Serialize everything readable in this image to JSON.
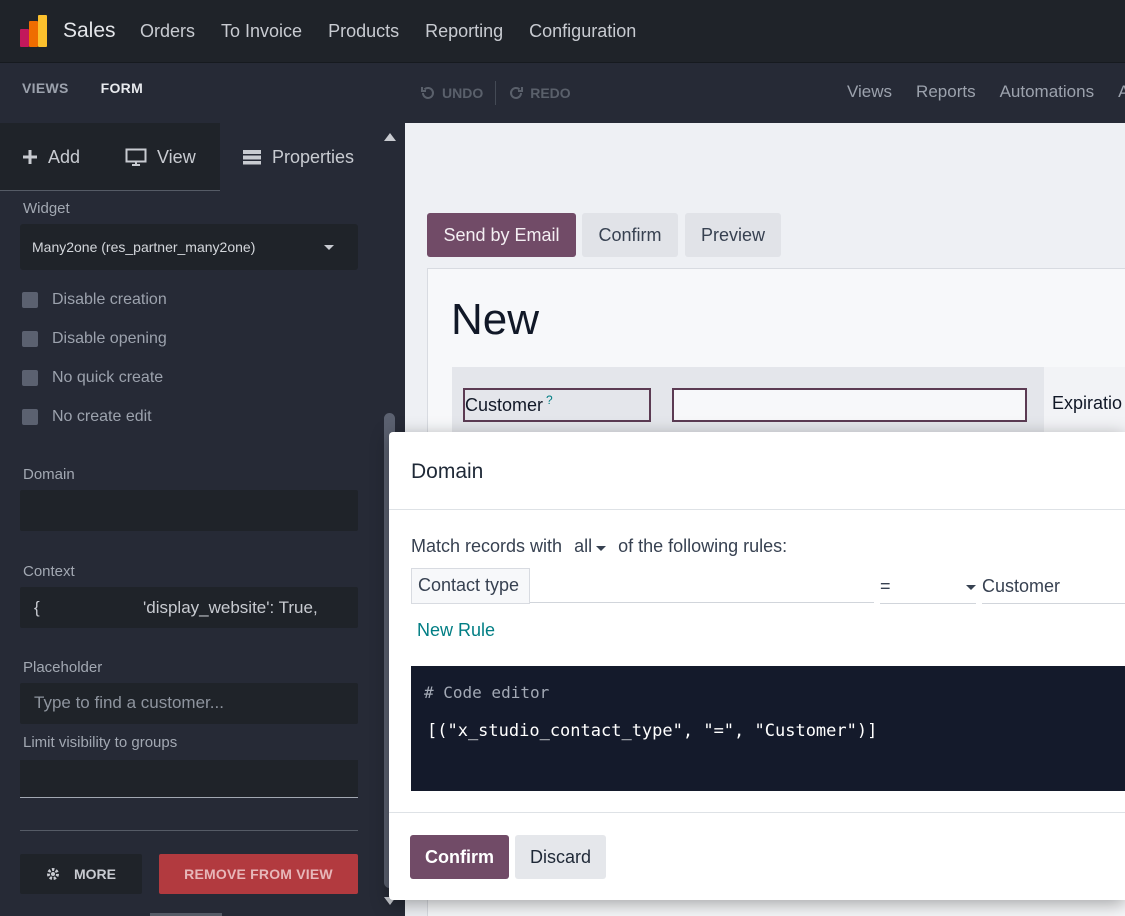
{
  "app": {
    "name": "Sales",
    "nav": [
      "Orders",
      "To Invoice",
      "Products",
      "Reporting",
      "Configuration"
    ],
    "logo_colors": [
      "#c2185b",
      "#ef6c00",
      "#fbc02d"
    ]
  },
  "studio_bar": {
    "tabs": [
      "VIEWS",
      "FORM"
    ],
    "active_tab": "FORM",
    "undo_label": "UNDO",
    "redo_label": "REDO",
    "right_links": [
      "Views",
      "Reports",
      "Automations",
      "A"
    ]
  },
  "sidebar": {
    "tabs": {
      "add": "Add",
      "view": "View",
      "properties": "Properties"
    },
    "widget": {
      "label": "Widget",
      "value": "Many2one (res_partner_many2one)"
    },
    "options": [
      {
        "label": "Disable creation",
        "checked": false
      },
      {
        "label": "Disable opening",
        "checked": false
      },
      {
        "label": "No quick create",
        "checked": false
      },
      {
        "label": "No create edit",
        "checked": false
      }
    ],
    "domain": {
      "label": "Domain",
      "value": ""
    },
    "context": {
      "label": "Context",
      "brace": "{",
      "value": "'display_website': True,"
    },
    "placeholder": {
      "label": "Placeholder",
      "value": "Type to find a customer..."
    },
    "groups": {
      "label": "Limit visibility to groups",
      "value": ""
    },
    "more_label": "MORE",
    "remove_label": "REMOVE FROM VIEW"
  },
  "form": {
    "buttons": {
      "send": "Send by Email",
      "confirm": "Confirm",
      "preview": "Preview"
    },
    "title": "New",
    "customer_label": "Customer",
    "customer_help": "?",
    "expiration_label": "Expiratio"
  },
  "modal": {
    "title": "Domain",
    "match_prefix": "Match records with",
    "match_mode": "all",
    "match_suffix": "of the following rules:",
    "rule": {
      "field": "Contact type",
      "operator": "=",
      "value": "Customer"
    },
    "new_rule": "New Rule",
    "code_comment": "# Code editor",
    "code_value": "[(\"x_studio_contact_type\", \"=\", \"Customer\")]",
    "confirm": "Confirm",
    "discard": "Discard"
  },
  "colors": {
    "primary": "#714b67",
    "link": "#017e84",
    "danger": "#b23a3f"
  }
}
